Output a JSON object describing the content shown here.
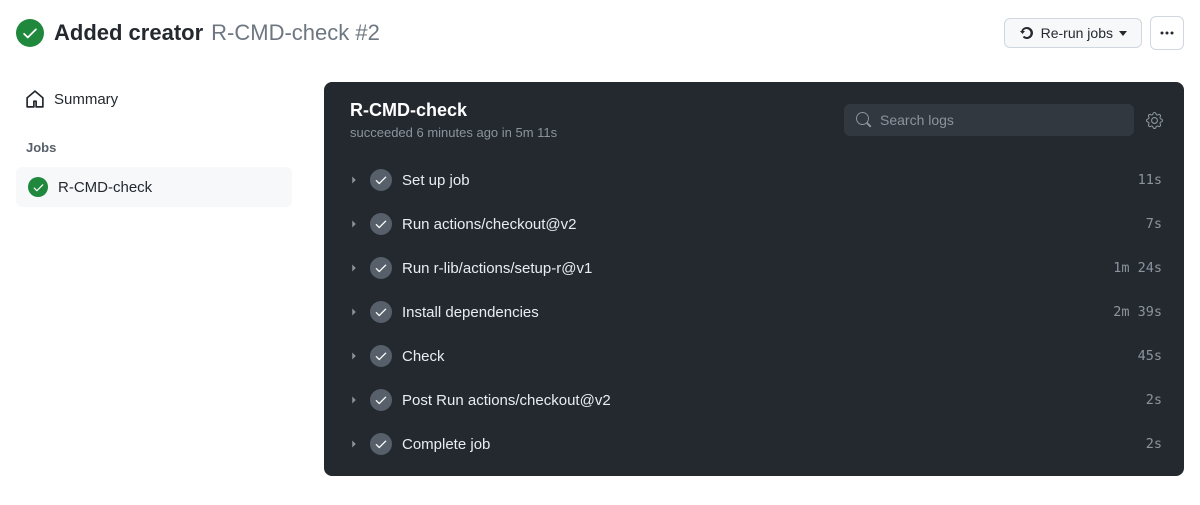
{
  "header": {
    "title": "Added creator",
    "subtitle": "R-CMD-check #2",
    "rerun_label": "Re-run jobs"
  },
  "sidebar": {
    "summary_label": "Summary",
    "jobs_heading": "Jobs",
    "job_name": "R-CMD-check"
  },
  "main": {
    "title": "R-CMD-check",
    "status_line": "succeeded 6 minutes ago in 5m 11s",
    "search_placeholder": "Search logs"
  },
  "steps": [
    {
      "name": "Set up job",
      "time": "11s"
    },
    {
      "name": "Run actions/checkout@v2",
      "time": "7s"
    },
    {
      "name": "Run r-lib/actions/setup-r@v1",
      "time": "1m 24s"
    },
    {
      "name": "Install dependencies",
      "time": "2m 39s"
    },
    {
      "name": "Check",
      "time": "45s"
    },
    {
      "name": "Post Run actions/checkout@v2",
      "time": "2s"
    },
    {
      "name": "Complete job",
      "time": "2s"
    }
  ]
}
